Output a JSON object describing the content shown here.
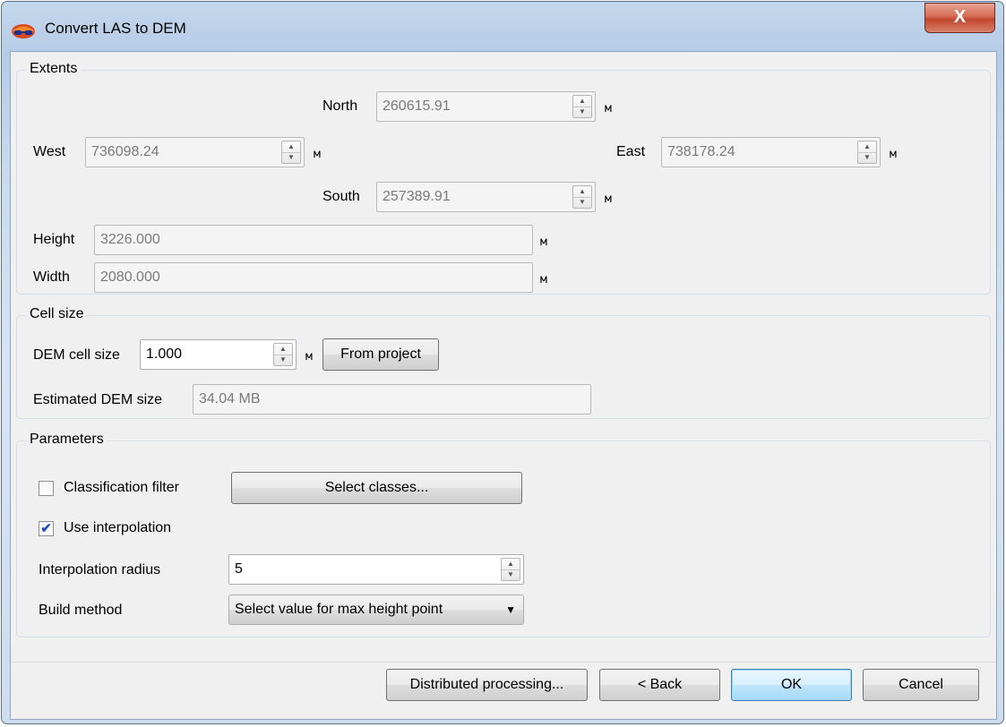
{
  "window": {
    "title": "Convert LAS to DEM",
    "close_label": "X"
  },
  "extents": {
    "group_title": "Extents",
    "north": {
      "label": "North",
      "value": "260615.91",
      "unit": "м"
    },
    "west": {
      "label": "West",
      "value": "736098.24",
      "unit": "м"
    },
    "east": {
      "label": "East",
      "value": "738178.24",
      "unit": "м"
    },
    "south": {
      "label": "South",
      "value": "257389.91",
      "unit": "м"
    },
    "height": {
      "label": "Height",
      "value": "3226.000",
      "unit": "м"
    },
    "width": {
      "label": "Width",
      "value": "2080.000",
      "unit": "м"
    }
  },
  "cell_size": {
    "group_title": "Cell size",
    "dem_cell_size": {
      "label": "DEM cell size",
      "value": "1.000",
      "unit": "м"
    },
    "from_project_label": "From project",
    "estimated": {
      "label": "Estimated DEM size",
      "value": "34.04 MB"
    }
  },
  "parameters": {
    "group_title": "Parameters",
    "classification_filter": {
      "label": "Classification filter",
      "checked": false
    },
    "select_classes_label": "Select classes...",
    "use_interpolation": {
      "label": "Use interpolation",
      "checked": true
    },
    "interpolation_radius": {
      "label": "Interpolation radius",
      "value": "5"
    },
    "build_method": {
      "label": "Build method",
      "value": "Select value for max height point"
    }
  },
  "buttons": {
    "distributed": "Distributed processing...",
    "back": "< Back",
    "ok": "OK",
    "cancel": "Cancel"
  },
  "icons": {
    "spin_up": "▲",
    "spin_down": "▼",
    "dropdown": "▼",
    "check": "✔"
  },
  "colors": {
    "close_button": "#c2452d",
    "default_button_border": "#3c7fb1",
    "window_frame": "#b6cce6"
  }
}
